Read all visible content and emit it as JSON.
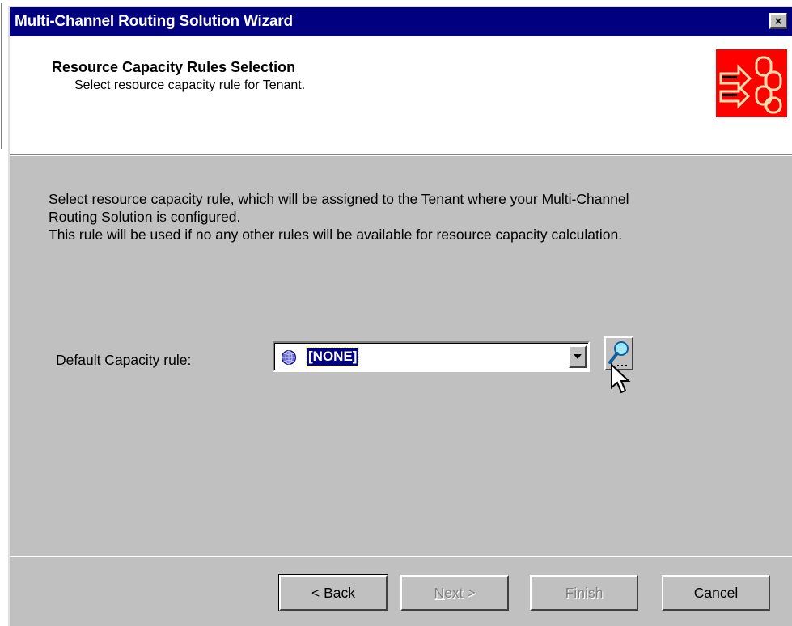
{
  "window": {
    "title": "Multi-Channel Routing Solution Wizard",
    "close_glyph": "×"
  },
  "header": {
    "title": "Resource Capacity Rules Selection",
    "subtitle": "Select resource capacity rule for Tenant.",
    "logo_icon": "routing-logo-icon"
  },
  "body": {
    "description_lines": [
      "Select resource capacity rule, which will be assigned to the Tenant where your Multi-Channel",
      "Routing Solution is configured.",
      "This rule will be used if no any other rules will be available for resource capacity calculation."
    ]
  },
  "capacity_rule": {
    "label": "Default Capacity rule:",
    "selected_value": "[NONE]",
    "item_icon": "globe-icon",
    "dropdown_icon": "chevron-down-icon",
    "lookup_icon": "magnifier-icon"
  },
  "buttons": {
    "back_prefix": "< ",
    "back_mnemonic": "B",
    "back_rest": "ack",
    "next_mnemonic": "N",
    "next_rest": "ext >",
    "finish": "Finish",
    "cancel": "Cancel"
  },
  "colors": {
    "titlebar": "#000080",
    "logo_bg": "#ff0000",
    "dialog_face": "#c0c0c0",
    "selection": "#000080"
  }
}
